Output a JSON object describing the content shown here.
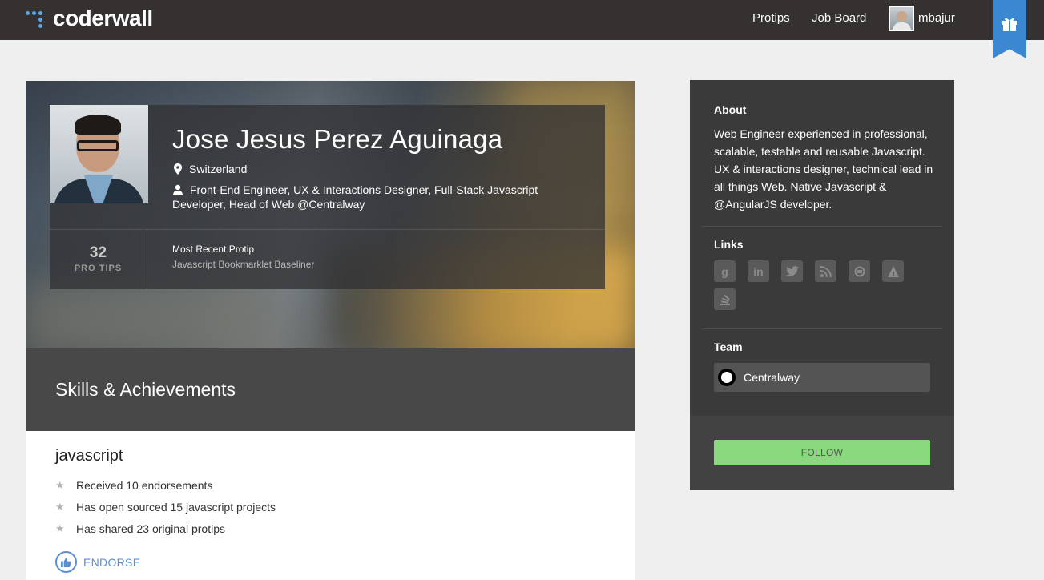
{
  "brand": {
    "name": "coderwall",
    "accent": "#5aa6e6"
  },
  "nav": {
    "protips": "Protips",
    "job_board": "Job Board",
    "user": "mbajur"
  },
  "profile": {
    "name": "Jose Jesus Perez Aguinaga",
    "location": "Switzerland",
    "title": "Front-End Engineer, UX & Interactions Designer, Full-Stack Javascript Developer, Head of Web @Centralway",
    "protips_count": "32",
    "protips_label": "PRO TIPS",
    "recent_protip_title": "Most Recent Protip",
    "recent_protip_link": "Javascript Bookmarklet Baseliner"
  },
  "skills": {
    "header": "Skills & Achievements",
    "items": [
      {
        "name": "javascript",
        "achievements": [
          "Received 10 endorsements",
          "Has open sourced 15 javascript projects",
          "Has shared 23 original protips"
        ],
        "endorse_label": "ENDORSE"
      }
    ]
  },
  "sidebar": {
    "about_title": "About",
    "about_text": "Web Engineer experienced in professional, scalable, testable and reusable Javascript. UX & interactions designer, technical lead in all things Web. Native Javascript & @AngularJS developer.",
    "links_title": "Links",
    "links": [
      "google-icon",
      "linkedin-icon",
      "twitter-icon",
      "rss-icon",
      "forrst-icon",
      "speakerdeck-icon",
      "stackoverflow-icon"
    ],
    "team_title": "Team",
    "team_name": "Centralway",
    "follow_label": "FOLLOW",
    "follow_color": "#8ad97e"
  }
}
